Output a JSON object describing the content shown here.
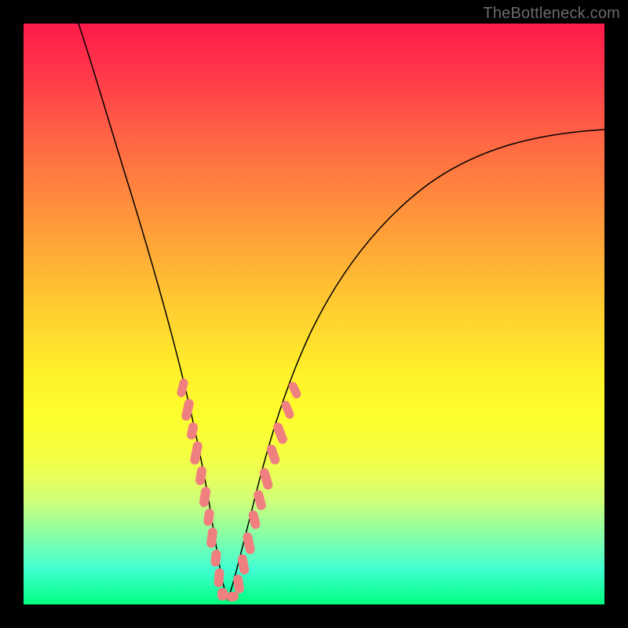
{
  "watermark": "TheBottleneck.com",
  "chart_data": {
    "type": "line",
    "title": "",
    "xlabel": "",
    "ylabel": "",
    "xlim": [
      0,
      100
    ],
    "ylim": [
      0,
      100
    ],
    "grid": false,
    "legend": false,
    "series": [
      {
        "name": "left-branch",
        "x": [
          0,
          5,
          10,
          15,
          20,
          25,
          28,
          30,
          32,
          33
        ],
        "y": [
          100,
          79,
          59,
          42,
          26,
          12,
          5,
          2,
          0.5,
          0
        ]
      },
      {
        "name": "right-branch",
        "x": [
          33,
          35,
          38,
          42,
          48,
          55,
          63,
          72,
          82,
          92,
          100
        ],
        "y": [
          0,
          2,
          8,
          18,
          32,
          46,
          58,
          67,
          74,
          78,
          80
        ]
      }
    ],
    "annotations": {
      "left_glaze_x": [
        20,
        32
      ],
      "left_glaze_y": [
        26,
        0.5
      ],
      "right_glaze_x": [
        33,
        43
      ],
      "right_glaze_y": [
        0,
        20
      ],
      "bottom_glaze_x": [
        30,
        36
      ],
      "bottom_glaze_y": [
        2,
        3
      ]
    },
    "background_gradient": {
      "top": "#ff1a4a",
      "mid": "#fff02a",
      "bottom": "#00ff7f"
    }
  }
}
